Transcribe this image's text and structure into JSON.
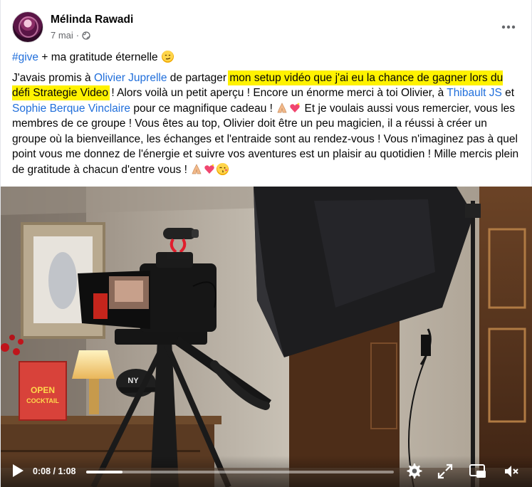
{
  "post": {
    "author": "Mélinda Rawadi",
    "date": "7 mai",
    "dot": "·",
    "more_label": "•••"
  },
  "text": {
    "hashtag": "#give",
    "line1_rest": " + ma gratitude éternelle ",
    "p_a": "J'avais promis à ",
    "mention_1": "Olivier Juprelle",
    "p_b": " de partager ",
    "highlight": "mon setup vidéo que j'ai eu la chance de gagner lors du défi Strategie Video",
    "p_c": " ! Alors voilà un petit aperçu ! Encore un énorme merci à toi Olivier, à ",
    "mention_2": "Thibault JS",
    "p_d": " et ",
    "mention_3": "Sophie Berque Vinclaire",
    "p_e": " pour ce magnifique cadeau ! ",
    "p_f": " Et je voulais aussi vous remercier, vous les membres de ce groupe ! Vous êtes au top, Olivier doit être un peu magicien, il a réussi à créer un groupe où la bienveillance, les échanges et l'entraide sont au rendez-vous ! Vous n'imaginez pas à quel point vous me donnez de l'énergie et suivre vos aventures est un plaisir au quotidien ! Mille mercis plein de gratitude à chacun d'entre vous ! "
  },
  "video": {
    "current_time": "0:08",
    "separator": " / ",
    "duration": "1:08",
    "progress_fraction": 0.118,
    "sign_text_1": "OPEN",
    "sign_text_2": "COCKTAIL",
    "cap_text": "NY"
  },
  "icons": {
    "globe": "globe-icon",
    "more": "more-options-icon",
    "play": "play-icon",
    "settings": "settings-gear-icon",
    "fullscreen": "fullscreen-icon",
    "pip": "picture-in-picture-icon",
    "mute": "volume-muted-icon"
  },
  "colors": {
    "link": "#216fdb",
    "highlight": "#fff200",
    "meta_text": "#65676b"
  }
}
